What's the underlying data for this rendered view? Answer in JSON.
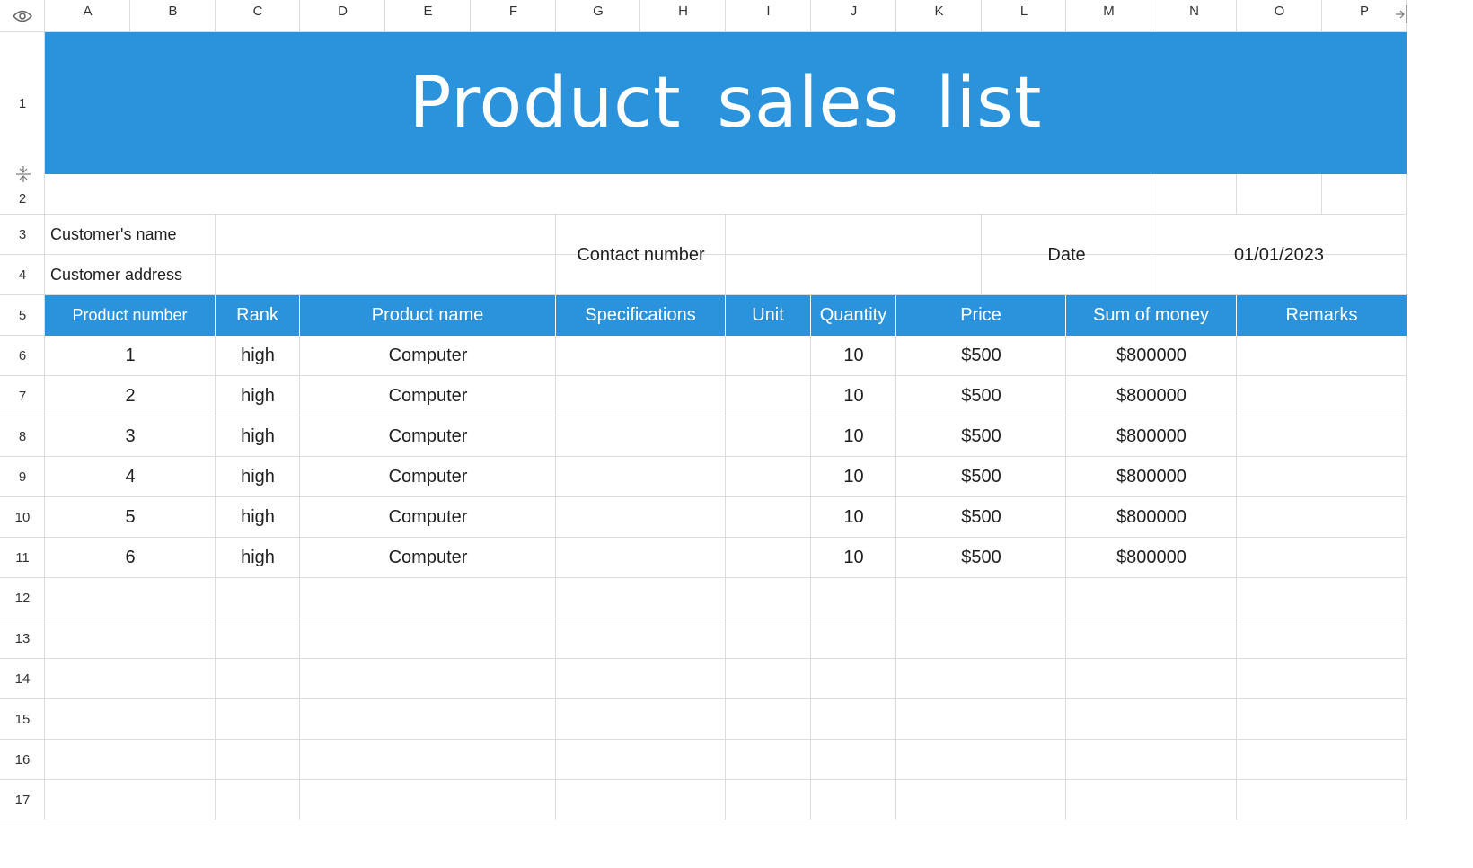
{
  "column_headers": [
    "A",
    "B",
    "C",
    "D",
    "E",
    "F",
    "G",
    "H",
    "I",
    "J",
    "K",
    "L",
    "M",
    "N",
    "O",
    "P"
  ],
  "row_headers": [
    "1",
    "2",
    "3",
    "4",
    "5",
    "6",
    "7",
    "8",
    "9",
    "10",
    "11",
    "12",
    "13",
    "14",
    "15",
    "16",
    "17"
  ],
  "title": "Product sales list",
  "info": {
    "customer_name_label": "Customer's name",
    "customer_address_label": "Customer address",
    "contact_label": "Contact number",
    "date_label": "Date",
    "date_value": "01/01/2023"
  },
  "table": {
    "headers": [
      "Product number",
      "Rank",
      "Product name",
      "Specifications",
      "Unit",
      "Quantity",
      "Price",
      "Sum of money",
      "Remarks"
    ],
    "rows": [
      [
        "1",
        "high",
        "Computer",
        "",
        "",
        "10",
        "$500",
        "$800000",
        ""
      ],
      [
        "2",
        "high",
        "Computer",
        "",
        "",
        "10",
        "$500",
        "$800000",
        ""
      ],
      [
        "3",
        "high",
        "Computer",
        "",
        "",
        "10",
        "$500",
        "$800000",
        ""
      ],
      [
        "4",
        "high",
        "Computer",
        "",
        "",
        "10",
        "$500",
        "$800000",
        ""
      ],
      [
        "5",
        "high",
        "Computer",
        "",
        "",
        "10",
        "$500",
        "$800000",
        ""
      ],
      [
        "6",
        "high",
        "Computer",
        "",
        "",
        "10",
        "$500",
        "$800000",
        ""
      ]
    ]
  },
  "colors": {
    "accent": "#2b93dc",
    "grid": "#dcdcdc",
    "header_text": "#ffffff"
  },
  "icons": {
    "corner": "eye-icon",
    "row_toggle": "collapse-rows-icon",
    "col_toggle": "expand-columns-icon"
  }
}
